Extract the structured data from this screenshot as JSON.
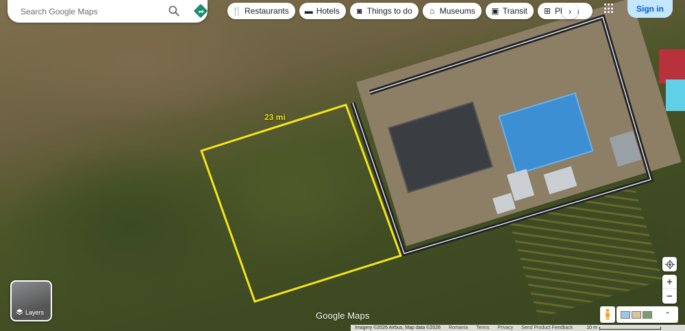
{
  "search": {
    "placeholder": "Search Google Maps"
  },
  "chips": [
    {
      "label": "Restaurants",
      "icon": "restaurant-icon"
    },
    {
      "label": "Hotels",
      "icon": "hotel-icon"
    },
    {
      "label": "Things to do",
      "icon": "camera-icon"
    },
    {
      "label": "Museums",
      "icon": "museum-icon"
    },
    {
      "label": "Transit",
      "icon": "transit-icon"
    },
    {
      "label": "Pharm",
      "icon": "pharmacy-icon"
    }
  ],
  "header": {
    "signin_label": "Sign in"
  },
  "measurement": {
    "label": "23 mi",
    "color": "#f4e61b"
  },
  "layers": {
    "label": "Layers"
  },
  "logo": {
    "text": "Google Maps"
  },
  "footer": {
    "copyright": "Imagery ©2026 Airbus, Map data ©2026",
    "links": [
      "Romania",
      "Terms",
      "Privacy",
      "Send Product Feedback"
    ],
    "scale_label": "10 m"
  },
  "colors": {
    "accent": "#0b57d0",
    "signin_bg": "#c2e7ff",
    "directions": "#1a73e8"
  }
}
